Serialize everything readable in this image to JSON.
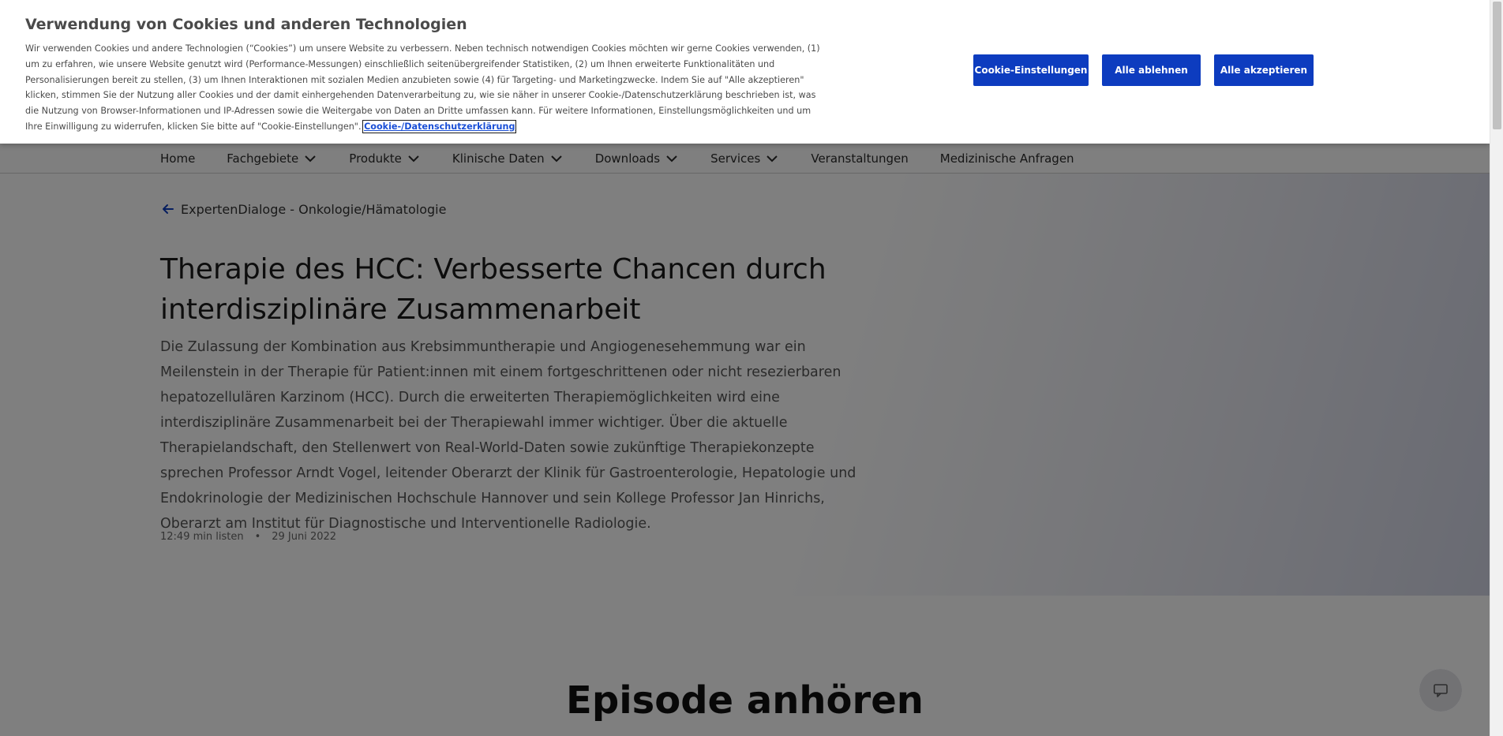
{
  "cookie_banner": {
    "title": "Verwendung von Cookies und anderen Technologien",
    "text": "Wir verwenden Cookies und andere Technologien (“Cookies”) um unsere Website zu verbessern. Neben technisch notwendigen Cookies möchten wir gerne Cookies verwenden, (1) um zu erfahren, wie unsere Website genutzt wird (Performance-Messungen) einschließlich seitenübergreifender Statistiken, (2) um Ihnen erweiterte Funktionalitäten und Personalisierungen bereit zu stellen, (3) um Ihnen Interaktionen mit sozialen Medien anzubieten sowie (4) für Targeting- und Marketingzwecke. Indem Sie auf \"Alle akzeptieren\" klicken, stimmen Sie der Nutzung aller Cookies und der damit einhergehenden Datenverarbeitung zu, wie sie näher in unserer Cookie-/Datenschutzerklärung beschrieben ist, was die Nutzung von Browser-Informationen und IP-Adressen sowie die Weitergabe von Daten an Dritte umfassen kann. Für weitere Informationen, Einstellungsmöglichkeiten und um Ihre Einwilligung zu widerrufen, klicken Sie bitte auf \"Cookie-Einstellungen\".",
    "link_label": "Cookie-/Datenschutzerklärung",
    "buttons": {
      "settings": "Cookie-Einstellungen",
      "reject_all": "Alle ablehnen",
      "accept_all": "Alle akzeptieren"
    },
    "button_color": "#0d3cbf"
  },
  "nav": {
    "items": [
      {
        "label": "Home",
        "has_dropdown": false
      },
      {
        "label": "Fachgebiete",
        "has_dropdown": true
      },
      {
        "label": "Produkte",
        "has_dropdown": true
      },
      {
        "label": "Klinische Daten",
        "has_dropdown": true
      },
      {
        "label": "Downloads",
        "has_dropdown": true
      },
      {
        "label": "Services",
        "has_dropdown": true
      },
      {
        "label": "Veranstaltungen",
        "has_dropdown": false
      },
      {
        "label": "Medizinische Anfragen",
        "has_dropdown": false
      }
    ]
  },
  "article": {
    "back_link": "ExpertenDialoge - Onkologie/Hämatologie",
    "title": "Therapie des HCC: Verbesserte Chancen durch interdisziplinäre Zusammenarbeit",
    "intro": "Die Zulassung der Kombination aus Krebsimmuntherapie und Angiogenesehemmung war ein Meilenstein in der Therapie für Patient:innen mit einem fortgeschrittenen oder nicht resezierbaren hepatozellulären Karzinom (HCC). Durch die erweiterten Therapiemöglichkeiten wird eine interdisziplinäre Zusammenarbeit bei der Therapiewahl immer wichtiger. Über die aktuelle Therapielandschaft, den Stellenwert von Real-World-Daten sowie zukünftige Therapiekonzepte sprechen Professor Arndt Vogel, leitender Oberarzt der Klinik für Gastroenterologie, Hepatologie und Endokrinologie der Medizinischen Hochschule Hannover und sein Kollege Professor Jan Hinrichs, Oberarzt am Institut für Diagnostische und Interventionelle Radiologie.",
    "duration": "12:49 min listen",
    "separator": "•",
    "date": "29 Juni 2022"
  },
  "episode": {
    "heading": "Episode anhören"
  },
  "icons": {
    "back": "arrow-left-icon",
    "dropdown": "chevron-down-icon",
    "chat": "chat-icon"
  },
  "colors": {
    "accent": "#0d3cbf",
    "overlay": "rgba(0,0,0,0.5)"
  }
}
